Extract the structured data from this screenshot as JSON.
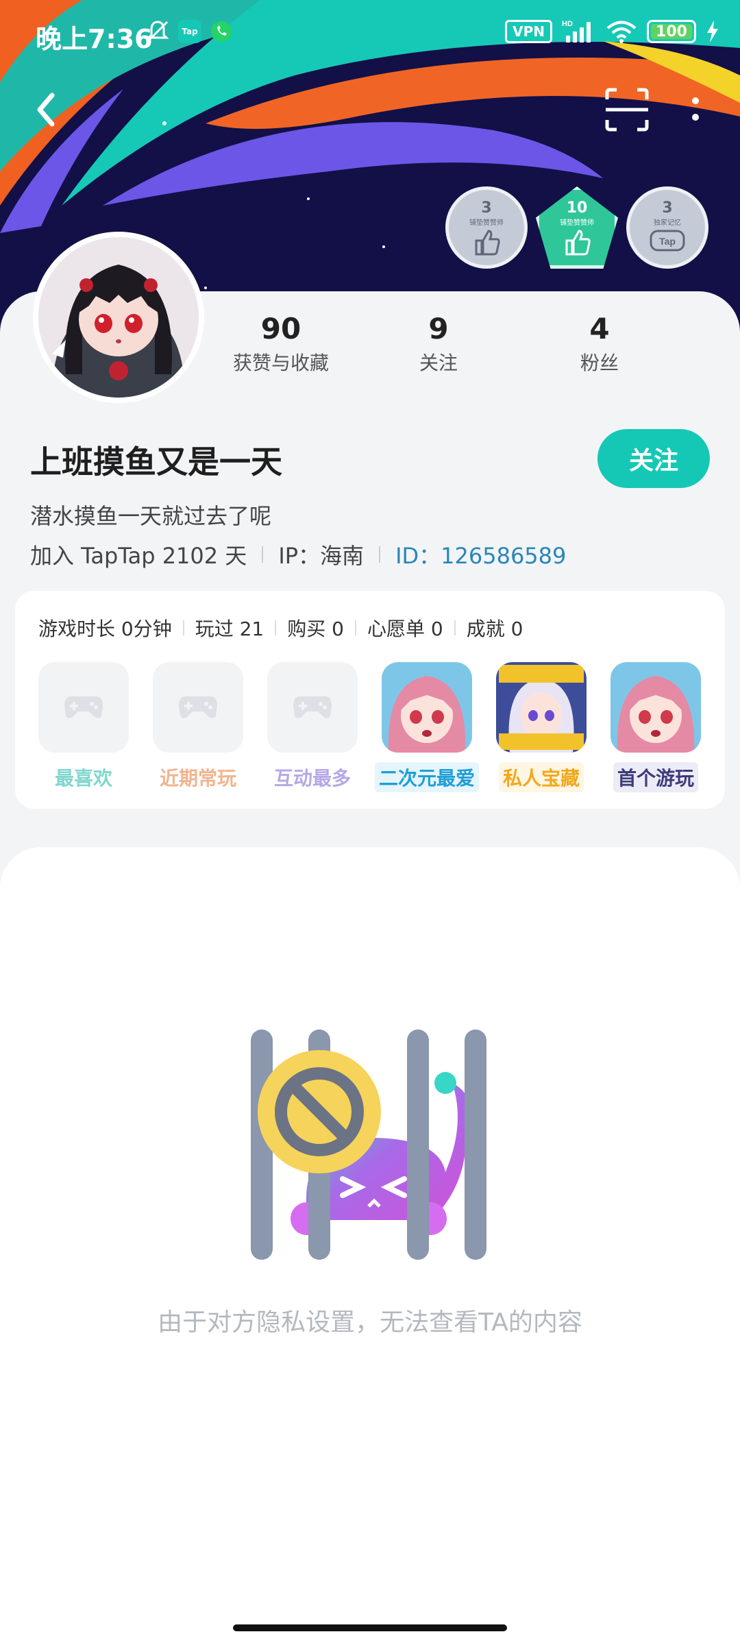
{
  "status_bar": {
    "time": "晚上7:36",
    "vpn": "VPN",
    "network": "HD",
    "battery": "100"
  },
  "header": {
    "badges": [
      {
        "num": "3",
        "sub": "铺垫赞赞师",
        "icon": "thumbs-up-icon"
      },
      {
        "num": "10",
        "sub": "铺垫赞赞师",
        "icon": "thumbs-up-icon"
      },
      {
        "num": "3",
        "sub": "独家记忆",
        "icon": "tap-controller-icon"
      }
    ]
  },
  "profile": {
    "stats": [
      {
        "value": "90",
        "label": "获赞与收藏"
      },
      {
        "value": "9",
        "label": "关注"
      },
      {
        "value": "4",
        "label": "粉丝"
      }
    ],
    "name": "上班摸鱼又是一天",
    "follow_label": "关注",
    "bio": "潜水摸鱼一天就过去了呢",
    "joined": "加入 TapTap 2102 天",
    "ip": "IP：海南",
    "id": "ID：126586589"
  },
  "games": {
    "stats": [
      "游戏时长 0分钟",
      "玩过 21",
      "购买 0",
      "心愿单 0",
      "成就 0"
    ],
    "items": [
      {
        "label": "最喜欢",
        "color": "#7fd7cf",
        "bg": "#ffffff",
        "filled": false
      },
      {
        "label": "近期常玩",
        "color": "#f2b48f",
        "bg": "#ffffff",
        "filled": false
      },
      {
        "label": "互动最多",
        "color": "#b6a7e8",
        "bg": "#ffffff",
        "filled": false
      },
      {
        "label": "二次元最爱",
        "color": "#1e9fd6",
        "bg": "#e6f5fc",
        "filled": true
      },
      {
        "label": "私人宝藏",
        "color": "#f2a81d",
        "bg": "#fff6e3",
        "filled": true
      },
      {
        "label": "首个游玩",
        "color": "#3e3a7a",
        "bg": "#ececf6",
        "filled": true
      }
    ]
  },
  "content": {
    "empty_message": "由于对方隐私设置，无法查看TA的内容"
  },
  "colors": {
    "accent": "#15c8b6",
    "link": "#2a86b8"
  }
}
